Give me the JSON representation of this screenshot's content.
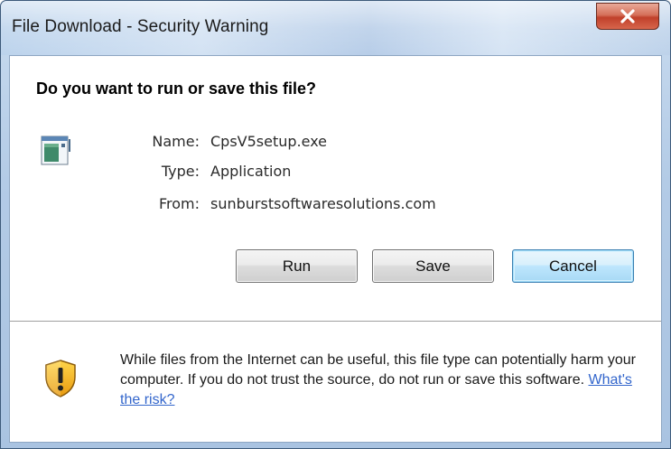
{
  "window": {
    "title": "File Download - Security Warning",
    "close_icon": "close-icon"
  },
  "dialog": {
    "heading": "Do you want to run or save this file?",
    "file_icon": "application-file-icon",
    "fields": {
      "name_label": "Name:",
      "name_value": "CpsV5setup.exe",
      "type_label": "Type:",
      "type_value": "Application",
      "from_label": "From:",
      "from_value": "sunburstsoftwaresolutions.com"
    },
    "buttons": {
      "run": "Run",
      "save": "Save",
      "cancel": "Cancel",
      "default": "cancel"
    },
    "warning": {
      "icon": "shield-warning-icon",
      "text": "While files from the Internet can be useful, this file type can potentially harm your computer. If you do not trust the source, do not run or save this software. ",
      "link": "What's the risk?"
    }
  },
  "colors": {
    "link": "#3366cc",
    "close_button": "#c0402a",
    "default_button_border": "#3c7fb1"
  }
}
